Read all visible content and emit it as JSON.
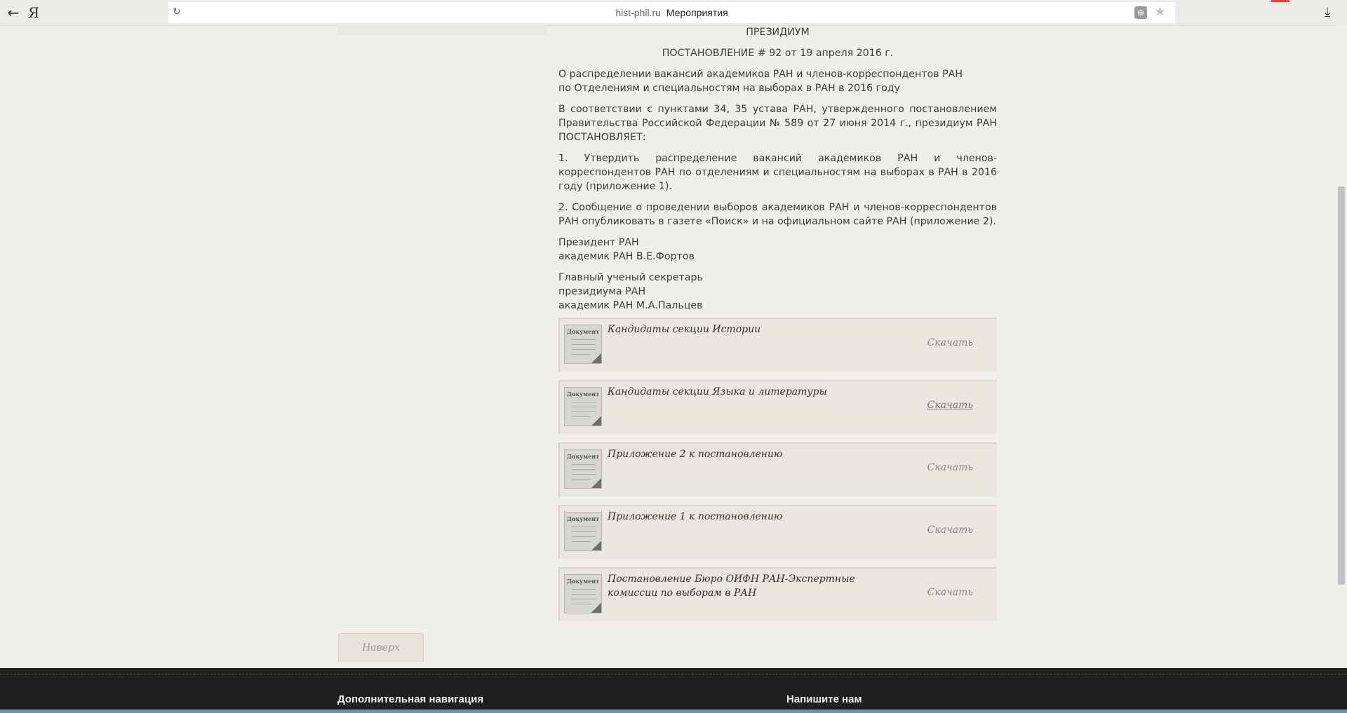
{
  "browser": {
    "back_icon": "arrow-left-icon",
    "logo": "Я",
    "domain": "hist-phil.ru",
    "page_title": "Мероприятия"
  },
  "decree": {
    "heading": "ПРЕЗИДИУМ",
    "number": "ПОСТАНОВЛЕНИЕ # 92 от 19 апреля 2016 г.",
    "subject_line1": "О распределении вакансий академиков РАН и членов-корреспондентов РАН",
    "subject_line2": "по Отделениям и специальностям на выборах в РАН в 2016 году",
    "preamble": "В соответствии с пунктами 34, 35 устава РАН, утвержденного постановлением Правительства Российской Федерации № 589 от 27 июня 2014 г., президиум РАН ПОСТАНОВЛЯЕТ:",
    "item1": "1. Утвердить распределение вакансий академиков РАН и членов-корреспондентов РАН по отделениям и специальностям на выборах в РАН в 2016 году (приложение 1).",
    "item2": "2. Сообщение о проведении выборов академиков РАН и членов-корреспондентов РАН опубликовать в газете «Поиск» и на официальном сайте РАН (приложение 2).",
    "president_line1": "Президент РАН",
    "president_line2": "академик РАН В.Е.Фортов",
    "secretary_line1": "Главный ученый секретарь",
    "secretary_line2": "президиума РАН",
    "secretary_line3": "академик РАН М.А.Пальцев"
  },
  "documents": [
    {
      "icon_label": "Документ",
      "title": "Кандидаты секции Истории",
      "download": "Скачать"
    },
    {
      "icon_label": "Документ",
      "title": "Кандидаты секции Языка и литературы",
      "download": "Скачать"
    },
    {
      "icon_label": "Документ",
      "title": "Приложение 2 к постановлению",
      "download": "Скачать"
    },
    {
      "icon_label": "Документ",
      "title": "Приложение 1 к постановлению",
      "download": "Скачать"
    },
    {
      "icon_label": "Документ",
      "title": "Постановление Бюро ОИФН РАН-Экспертные комиссии по выборам в РАН",
      "download": "Скачать"
    }
  ],
  "to_top": "Наверх",
  "footer": {
    "nav_heading": "Дополнительная навигация",
    "contact_heading": "Напишите нам"
  }
}
